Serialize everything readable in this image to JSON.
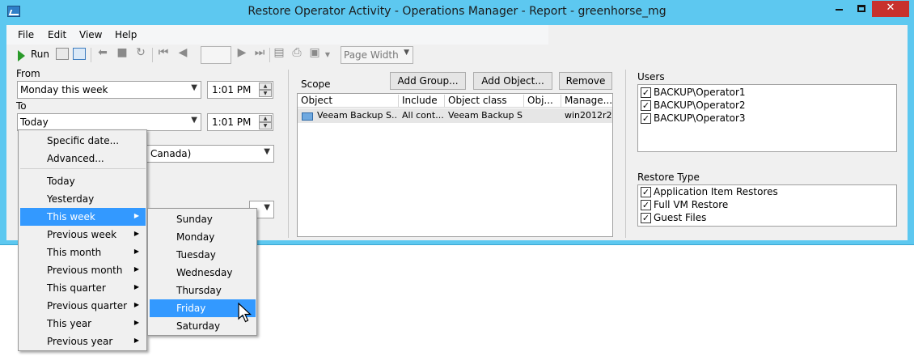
{
  "window": {
    "title": "Restore Operator Activity - Operations Manager - Report - greenhorse_mg",
    "caption_close": "✕"
  },
  "menubar": [
    "File",
    "Edit",
    "View",
    "Help"
  ],
  "toolbar": {
    "run_label": "Run",
    "page_number": "",
    "zoom": "Page Width"
  },
  "form": {
    "from_label": "From",
    "from_value": "Monday this week",
    "from_time": "1:01 PM",
    "to_label": "To",
    "to_value": "Today",
    "to_time": "1:01 PM",
    "timezone_partial": "Canada)"
  },
  "scope": {
    "label": "Scope",
    "add_group": "Add Group...",
    "add_object": "Add Object...",
    "remove": "Remove",
    "columns": [
      "Object",
      "Include",
      "Object class",
      "Obj...",
      "Manage..."
    ],
    "rows": [
      {
        "object": "Veeam Backup S...",
        "include": "All cont...",
        "object_class": "Veeam Backup S...",
        "obj": "",
        "managed": "win2012r2"
      }
    ]
  },
  "users": {
    "label": "Users",
    "items": [
      {
        "label": "BACKUP\\Operator1",
        "checked": true
      },
      {
        "label": "BACKUP\\Operator2",
        "checked": true
      },
      {
        "label": "BACKUP\\Operator3",
        "checked": true
      }
    ]
  },
  "restore_type": {
    "label": "Restore Type",
    "items": [
      {
        "label": "Application Item Restores",
        "checked": true
      },
      {
        "label": "Full VM Restore",
        "checked": true
      },
      {
        "label": "Guest Files",
        "checked": true
      }
    ]
  },
  "date_menu": {
    "items": [
      {
        "label": "Specific date...",
        "submenu": false
      },
      {
        "label": "Advanced...",
        "submenu": false
      },
      {
        "label": "Today",
        "submenu": false
      },
      {
        "label": "Yesterday",
        "submenu": false
      },
      {
        "label": "This week",
        "submenu": true,
        "highlighted": true
      },
      {
        "label": "Previous week",
        "submenu": true
      },
      {
        "label": "This month",
        "submenu": true
      },
      {
        "label": "Previous month",
        "submenu": true
      },
      {
        "label": "This quarter",
        "submenu": true
      },
      {
        "label": "Previous quarter",
        "submenu": true
      },
      {
        "label": "This year",
        "submenu": true
      },
      {
        "label": "Previous year",
        "submenu": true
      }
    ]
  },
  "week_menu": {
    "items": [
      "Sunday",
      "Monday",
      "Tuesday",
      "Wednesday",
      "Thursday",
      "Friday",
      "Saturday"
    ],
    "highlighted": "Friday"
  },
  "colors": {
    "title_bar": "#5dc8f0",
    "highlight": "#3399ff",
    "close_button": "#c7312d"
  }
}
